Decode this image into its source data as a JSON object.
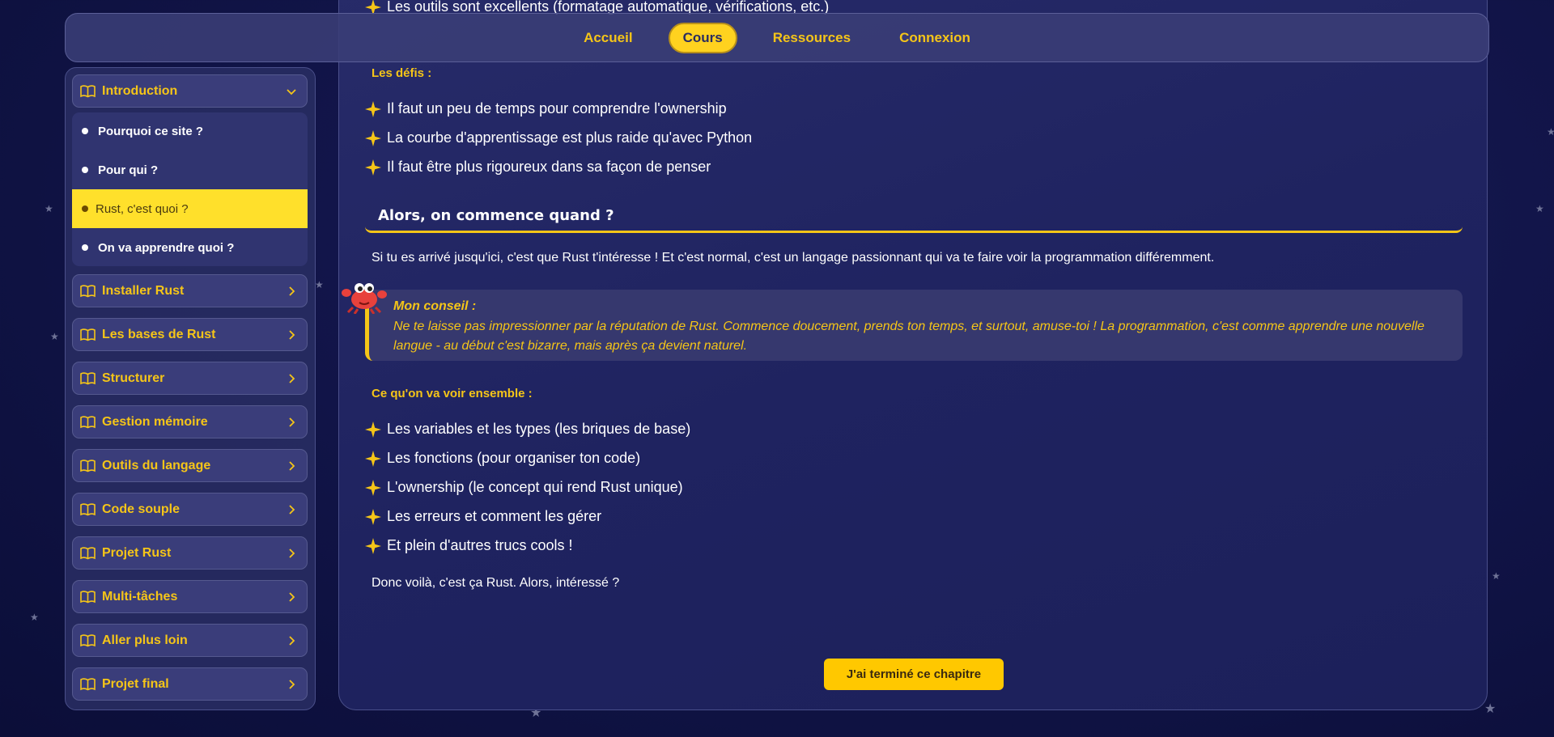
{
  "nav": {
    "links": [
      "Accueil",
      "Cours",
      "Ressources",
      "Connexion"
    ],
    "active": "Cours"
  },
  "sidebar": {
    "sections": [
      {
        "label": "Introduction",
        "icon": "book-icon",
        "expanded": true
      },
      {
        "label": "Installer Rust",
        "icon": "book-icon"
      },
      {
        "label": "Les bases de Rust",
        "icon": "book-icon"
      },
      {
        "label": "Structurer",
        "icon": "book-icon"
      },
      {
        "label": "Gestion mémoire",
        "icon": "book-icon"
      },
      {
        "label": "Outils du langage",
        "icon": "book-icon"
      },
      {
        "label": "Code souple",
        "icon": "book-icon"
      },
      {
        "label": "Projet Rust",
        "icon": "book-icon"
      },
      {
        "label": "Multi-tâches",
        "icon": "book-icon"
      },
      {
        "label": "Aller plus loin",
        "icon": "book-icon"
      },
      {
        "label": "Projet final",
        "icon": "book-icon"
      }
    ],
    "intro_items": [
      {
        "label": "Pourquoi ce site ?"
      },
      {
        "label": "Pour qui ?"
      },
      {
        "label": "Rust, c'est quoi ?",
        "active": true
      },
      {
        "label": "On va apprendre quoi ?"
      }
    ]
  },
  "content": {
    "top_item": "Les outils sont excellents (formatage automatique, vérifications, etc.)",
    "defis_title": "Les défis :",
    "defis": [
      "Il faut un peu de temps pour comprendre l'ownership",
      "La courbe d'apprentissage est plus raide qu'avec Python",
      "Il faut être plus rigoureux dans sa façon de penser"
    ],
    "section_title": "Alors, on commence quand ?",
    "intro_para": "Si tu es arrivé jusqu'ici, c'est que Rust t'intéresse ! Et c'est normal, c'est un langage passionnant qui va te faire voir la programmation différemment.",
    "tip": {
      "title": "Mon conseil :",
      "text": "Ne te laisse pas impressionner par la réputation de Rust. Commence doucement, prends ton temps, et surtout, amuse-toi ! La programmation, c'est comme apprendre une nouvelle langue - au début c'est bizarre, mais après ça devient naturel."
    },
    "voir_title": "Ce qu'on va voir ensemble :",
    "voir": [
      "Les variables et les types (les briques de base)",
      "Les fonctions (pour organiser ton code)",
      "L'ownership (le concept qui rend Rust unique)",
      "Les erreurs et comment les gérer",
      "Et plein d'autres trucs cools !"
    ],
    "closing": "Donc voilà, c'est ça Rust. Alors, intéressé ?",
    "done_button": "J'ai terminé ce chapitre"
  },
  "colors": {
    "accent": "#f5c518",
    "active_bg": "#ffe02b",
    "background": "#12154a"
  }
}
